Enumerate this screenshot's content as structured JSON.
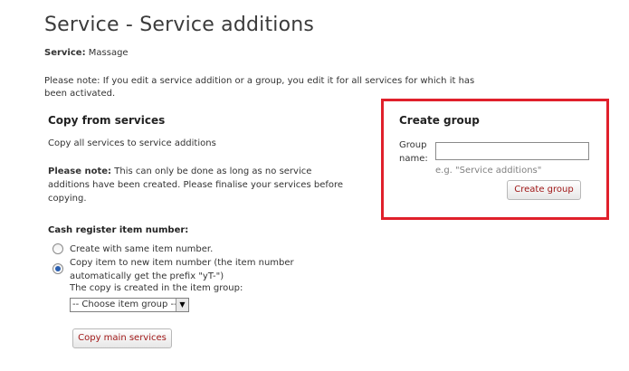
{
  "page": {
    "title": "Service - Service additions",
    "service_label": "Service:",
    "service_value": "Massage",
    "note": "Please note: If you edit a service addition or a group, you edit it for all services for which it has been activated."
  },
  "copy_section": {
    "heading": "Copy from services",
    "copy_all_text": "Copy all services to service additions",
    "please_note_label": "Please note:",
    "please_note_text": " This can only be done as long as no service additions have been created. Please finalise your services before copying.",
    "cash_register_label": "Cash register item number:",
    "options": [
      {
        "label": "Create with same item number.",
        "selected": false
      },
      {
        "label": "Copy item to new item number (the item number automatically get the prefix \"yT-\")",
        "selected": true
      }
    ],
    "item_group_text": "The copy is created in the item group:",
    "item_group_select": "-- Choose item group --",
    "copy_button": "Copy main services"
  },
  "create_group": {
    "heading": "Create group",
    "group_name_label": "Group name:",
    "group_name_value": "",
    "hint": "e.g. \"Service additions\"",
    "button": "Create group"
  },
  "colors": {
    "highlight_border": "#e0202b",
    "button_text": "#a01818"
  },
  "icons": {
    "select_arrow": "triangle-down"
  }
}
